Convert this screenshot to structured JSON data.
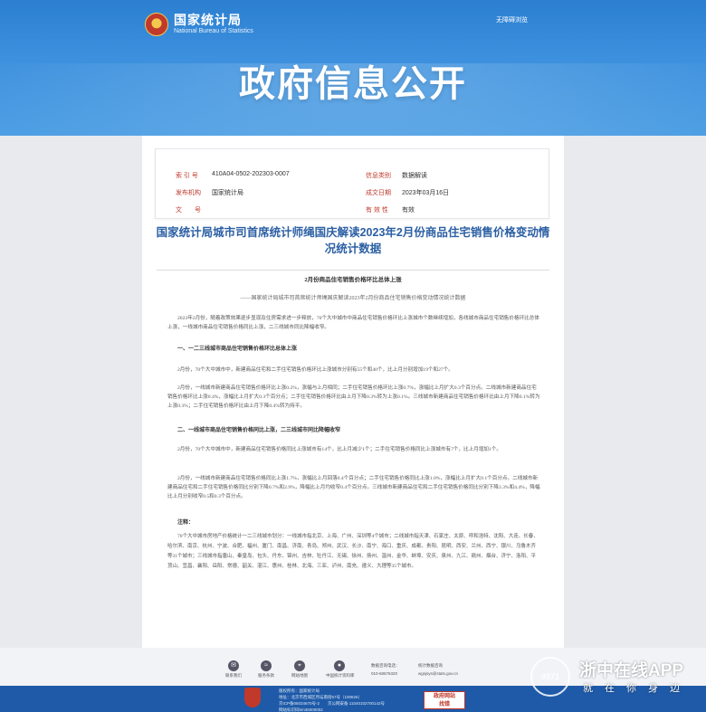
{
  "header": {
    "logo_cn": "国家统计局",
    "logo_en": "National Bureau of Statistics",
    "accessible_link": "无障碍浏览",
    "hero_title": "政府信息公开"
  },
  "meta": {
    "index_label": "索 引 号",
    "index_value": "410A04-0502-202303-0007",
    "category_label": "信息类别",
    "category_value": "数据解读",
    "issuer_label": "发布机构",
    "issuer_value": "国家统计局",
    "date_label": "成文日期",
    "date_value": "2023年03月16日",
    "docno_label": "文　　号",
    "docno_value": "",
    "validity_label": "有 效 性",
    "validity_value": "有效"
  },
  "article": {
    "title": "国家统计局城市司首席统计师绳国庆解读2023年2月份商品住宅销售价格变动情况统计数据",
    "subtitle": "2月份商品住宅销售价格环比总体上涨",
    "byline": "——国家统计局城市司首席统计师绳国庆解读2023年2月份商品住宅销售价格变动情况统计数据",
    "intro": "2023年2月份，随着政策效果逐步显现及住房需求进一步释放，70个大中城市中商品住宅销售价格环比上涨城市个数继续增加，各线城市商品住宅销售价格环比总体上涨，一线城市商品住宅销售价格同比上涨，二三线城市同比降幅收窄。",
    "section1": "一、一二三线城市商品住宅销售价格环比总体上涨",
    "s1p1": "2月份，70个大中城市中，新建商品住宅和二手住宅销售价格环比上涨城市分别有55个和40个，比上月分别增加19个和27个。",
    "s1p2": "2月份，一线城市新建商品住宅销售价格环比上涨0.2%，涨幅与上月相同；二手住宅销售价格环比上涨0.7%，涨幅比上月扩大0.3个百分点。二线城市新建商品住宅销售价格环比上涨0.4%，涨幅比上月扩大0.3个百分点；二手住宅销售价格环比由上月下降0.3%转为上涨0.1%。三线城市新建商品住宅销售价格环比由上月下降0.1%转为上涨0.3%；二手住宅销售价格环比由上月下降0.4%转为持平。",
    "section2": "二、一线城市商品住宅销售价格同比上涨，二三线城市同比降幅收窄",
    "s2p1": "2月份，70个大中城市中，新建商品住宅销售价格同比上涨城市有14个，比上月减少1个；二手住宅销售价格同比上涨城市有7个，比上月增加1个。",
    "s2p2": "2月份，一线城市新建商品住宅销售价格同比上涨1.7%，涨幅比上月回落0.4个百分点；二手住宅销售价格同比上涨1.0%，涨幅比上月扩大0.1个百分点。二线城市新建商品住宅和二手住宅销售价格同比分别下降0.7%和2.9%，降幅比上月均收窄0.4个百分点。三线城市新建商品住宅和二手住宅销售价格同比分别下降3.3%和4.4%，降幅比上月分别收窄0.5和0.3个百分点。",
    "note_label": "注释：",
    "note": "70个大中城市房地产价格统计一二三线城市划分：一线城市指北京、上海、广州、深圳等4个城市；二线城市指天津、石家庄、太原、呼和浩特、沈阳、大连、长春、哈尔滨、南京、杭州、宁波、合肥、福州、厦门、南昌、济南、青岛、郑州、武汉、长沙、南宁、海口、重庆、成都、贵阳、昆明、西安、兰州、西宁、银川、乌鲁木齐等31个城市；三线城市指唐山、秦皇岛、包头、丹东、锦州、吉林、牡丹江、无锡、徐州、扬州、温州、金华、蚌埠、安庆、泉州、九江、赣州、烟台、济宁、洛阳、平顶山、宜昌、襄阳、岳阳、常德、韶关、湛江、惠州、桂林、北海、三亚、泸州、南充、遵义、大理等35个城市。"
  },
  "footer": {
    "tools": [
      {
        "label": "联系我们",
        "icon": "mail-icon",
        "glyph": "✉"
      },
      {
        "label": "服务条款",
        "icon": "rss-icon",
        "glyph": "≈"
      },
      {
        "label": "网站地图",
        "icon": "sitemap-icon",
        "glyph": "⌖"
      },
      {
        "label": "中国统计资料库",
        "icon": "globe-icon",
        "glyph": "●"
      }
    ],
    "service_phone_label": "数据咨询电话：",
    "service_phone": "010-68576320",
    "service_email_label": "统计数据咨询",
    "service_email": "wgsjsys@stats.gov.cn",
    "host_line": "版权所有：国家统计局",
    "address_line": "地址：北京市西城区月坛南街57号（100826）",
    "icp_line": "京ICP备05034670号-2　　京公网安备 11040102700142号",
    "website_id": "网站标识码bm36000002",
    "gov_badge_line1": "政府网站",
    "gov_badge_line2": "找错"
  },
  "watermark": {
    "circle_text": "0571",
    "app_name": "浙中在线APP",
    "slogan": "就在你身边"
  }
}
